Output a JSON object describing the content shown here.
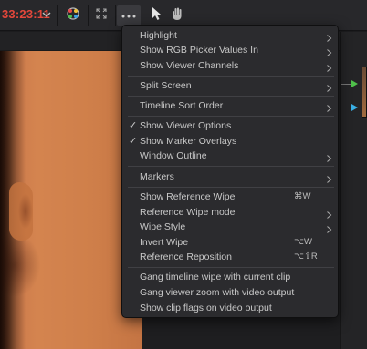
{
  "toolbar": {
    "timecode": "33:23:11",
    "icons": [
      "chevron-down-icon",
      "color-picker-icon",
      "fullscreen-icon",
      "more-options-icon",
      "pointer-icon",
      "hand-icon"
    ]
  },
  "menu": {
    "items": [
      {
        "label": "Highlight",
        "submenu": true
      },
      {
        "label": "Show RGB Picker Values In",
        "submenu": true
      },
      {
        "label": "Show Viewer Channels",
        "submenu": true
      },
      {
        "label": "Split Screen",
        "submenu": true
      },
      {
        "label": "Timeline Sort Order",
        "submenu": true
      },
      {
        "label": "Show Viewer Options",
        "checked": true
      },
      {
        "label": "Show Marker Overlays",
        "checked": true
      },
      {
        "label": "Window Outline",
        "submenu": true
      },
      {
        "label": "Markers",
        "submenu": true
      },
      {
        "label": "Show Reference Wipe",
        "shortcut": "⌘W"
      },
      {
        "label": "Reference Wipe mode",
        "submenu": true
      },
      {
        "label": "Wipe Style",
        "submenu": true
      },
      {
        "label": "Invert Wipe",
        "shortcut": "⌥W"
      },
      {
        "label": "Reference Reposition",
        "shortcut": "⌥⇧R"
      },
      {
        "label": "Gang timeline wipe with current clip"
      },
      {
        "label": "Gang viewer zoom with video output"
      },
      {
        "label": "Show clip flags on video output"
      }
    ]
  },
  "colors": {
    "timecode": "#e4473b",
    "menu_bg": "#2b2b2e",
    "menu_text": "#c8c8c8"
  }
}
